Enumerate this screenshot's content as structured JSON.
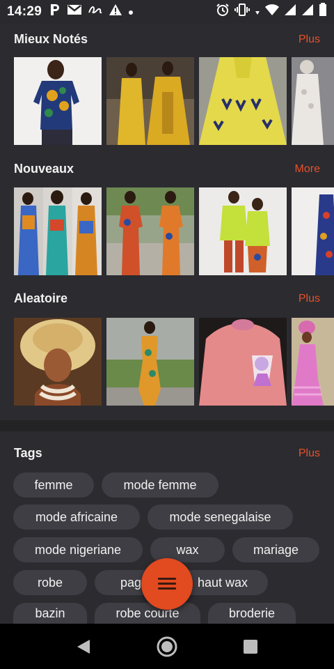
{
  "status_bar": {
    "time": "14:29",
    "left_icons": [
      "p-app-icon",
      "gmail-icon",
      "signature-icon",
      "warning-icon",
      "dot-icon"
    ],
    "right_icons": [
      "alarm-icon",
      "vibrate-icon",
      "signal-dot-icon",
      "wifi-icon",
      "cell-signal-icon",
      "cell-signal-2-icon",
      "battery-icon"
    ]
  },
  "sections": [
    {
      "title": "Mieux Notés",
      "more": "Plus",
      "thumbs": [
        "african print top",
        "yellow bazin dresses",
        "yellow embroidered dress",
        "white lace gown"
      ]
    },
    {
      "title": "Nouveaux",
      "more": "More",
      "thumbs": [
        "wax jumpsuits collage",
        "wax peplum outfits",
        "couple wax outfits",
        "wax jumpsuit"
      ]
    },
    {
      "title": "Aleatoire",
      "more": "Plus",
      "thumbs": [
        "gold gele headwrap",
        "wax fitted dress",
        "pink embroidered fabric",
        "pink mermaid dress"
      ]
    }
  ],
  "tags": {
    "title": "Tags",
    "more": "Plus",
    "items": [
      "femme",
      "mode femme",
      "mode africaine",
      "mode senegalaise",
      "mode nigeriane",
      "wax",
      "mariage",
      "robe",
      "pagne",
      "haut wax",
      "bazin",
      "robe courte",
      "broderie"
    ]
  },
  "colors": {
    "accent": "#e8512a",
    "fab": "#e24a1f",
    "chip": "#3e3e44",
    "background": "#2b2b30"
  },
  "fab_icon": "menu-icon",
  "nav": [
    "back-icon",
    "home-icon",
    "recents-icon"
  ]
}
